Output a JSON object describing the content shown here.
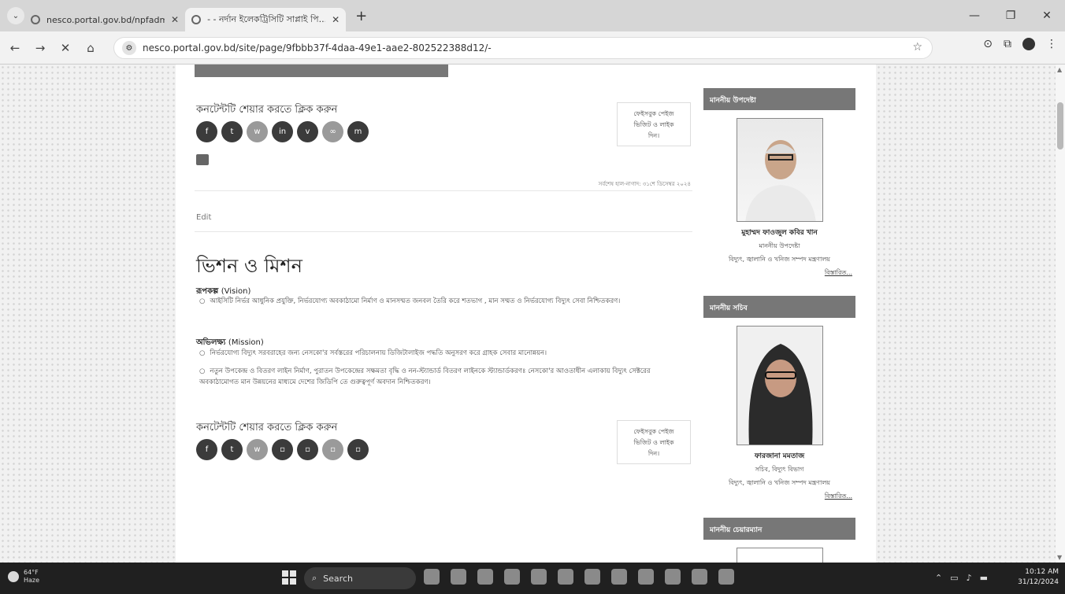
{
  "browser": {
    "tabs": [
      {
        "title": "nesco.portal.gov.bd/npfadmin..."
      },
      {
        "title": "- - নর্দান ইলেকট্রিসিটি সাপ্লাই পি..."
      }
    ],
    "url": "nesco.portal.gov.bd/site/page/9fbbb37f-4daa-49e1-aae2-802522388d12/-",
    "new_tab": "+",
    "star": "☆"
  },
  "page": {
    "share_title_1": "কনটেন্টটি শেয়ার করতে ক্লিক করুন",
    "fb_box_1": [
      "ফেইসবুক পেইজ",
      "ভিজিট ও লাইক",
      "দিন।"
    ],
    "updated": "সর্বশেষ হাল-নাগাদ: ৩১শে ডিসেম্বর ২০২৪",
    "edit": "Edit",
    "heading": "ভিশন ও মিশন",
    "vision_label": "রূপকল্প",
    "vision_label_en": "(Vision)",
    "vision_text": "আইসিটি নির্ভর আধুনিক প্রযুক্তি, নির্ভরযোগ্য অবকাঠামো নির্মাণ ও মানসম্মত জনবল তৈরি করে শতভাগ , মান সম্মত ও নির্ভরযোগ্য বিদ্যুৎ সেবা নিশ্চিতকরণ।",
    "mission_label": "অভিলক্ষ্য",
    "mission_label_en": "(Mission)",
    "mission_1": "নির্ভরযোগ্য বিদ্যুৎ সরবরাহের জন্য নেসকো'র সর্বস্তরের পরিচালনায় ডিজিটালাইজ পদ্ধতি অনুসরণ করে গ্রাহক সেবার মানোন্নয়ন।",
    "mission_2": "নতুন উপকেন্দ্র ও বিতরণ লাইন নির্মাণ, পুরাতন উপকেন্দ্রের সক্ষমতা বৃদ্ধি ও নন-স্ট্যান্ডার্ড বিতরণ লাইনকে স্ট্যান্ডার্ডকরণঃ নেসকো'র আওতাধীন এলাকায় বিদ্যুৎ সেক্টরের অবকাঠামোগত মান উন্নয়নের মাধ্যমে দেশের জিডিপি তে গুরুত্বপূর্ণ অবদান নিশ্চিতকরণ।",
    "share_title_2": "কনটেন্টটি শেয়ার করতে ক্লিক করুন",
    "fb_box_2": [
      "ফেইসবুক পেইজ",
      "ভিজিট ও লাইক",
      "দিন।"
    ]
  },
  "sidebar": {
    "adviser": {
      "header": "মাননীয় উপদেষ্টা",
      "name": "মুহাম্মদ ফাওজুল কবির খান",
      "title": "মাননীয় উপদেষ্টা",
      "ministry": "বিদ্যুৎ, জ্বালানি ও খনিজ সম্পদ মন্ত্রণালয়",
      "more": "বিস্তারিত..."
    },
    "secretary": {
      "header": "মাননীয় সচিব",
      "name": "ফারজানা মমতাজ",
      "title": "সচিব, বিদ্যুৎ বিভাগ",
      "ministry": "বিদ্যুৎ, জ্বালানি ও খনিজ সম্পদ মন্ত্রণালয়",
      "more": "বিস্তারিত..."
    },
    "chairman": {
      "header": "মাননীয় চেয়ারম্যান"
    }
  },
  "taskbar": {
    "weather_temp": "64°F",
    "weather_desc": "Haze",
    "search": "Search",
    "time": "10:12 AM",
    "date": "31/12/2024"
  }
}
